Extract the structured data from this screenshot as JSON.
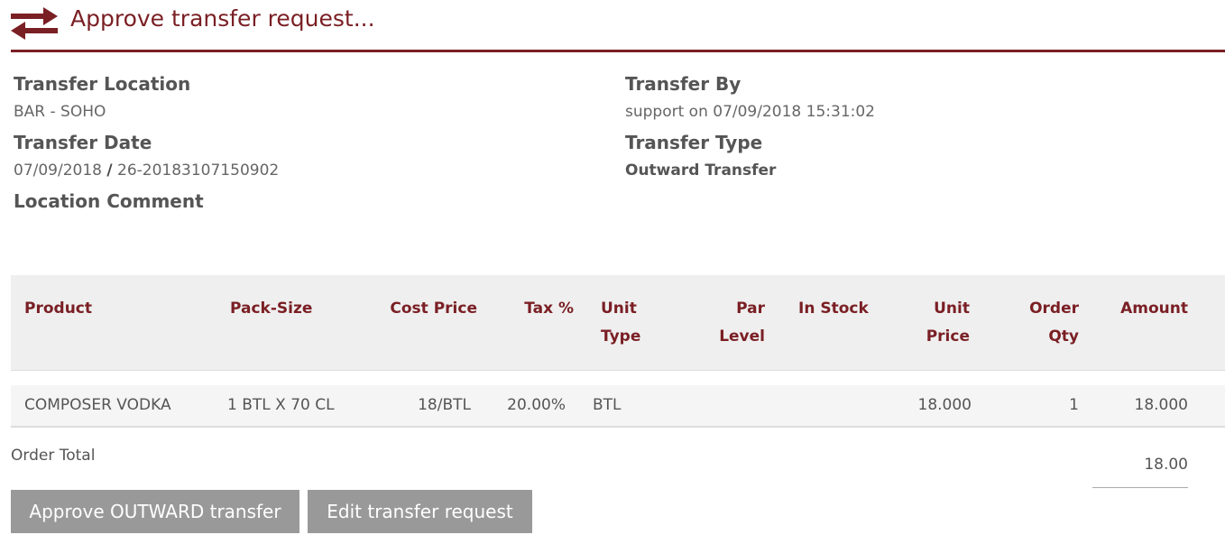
{
  "header": {
    "title": "Approve transfer request...",
    "icon": "transfer-arrows-icon",
    "accent_color": "#7a1f24"
  },
  "info": {
    "transfer_location_label": "Transfer Location",
    "transfer_location_value": "BAR - SOHO",
    "transfer_date_label": "Transfer Date",
    "transfer_date_value": "07/09/2018",
    "transfer_date_separator": "/",
    "transfer_reference": "26-20183107150902",
    "location_comment_label": "Location Comment",
    "transfer_by_label": "Transfer By",
    "transfer_by_value": "support on 07/09/2018 15:31:02",
    "transfer_type_label": "Transfer Type",
    "transfer_type_value": "Outward Transfer"
  },
  "table": {
    "headers": {
      "product": "Product",
      "pack_size": "Pack-Size",
      "cost_price": "Cost Price",
      "tax": "Tax %",
      "unit_type_1": "Unit",
      "unit_type_2": "Type",
      "par_level_1": "Par",
      "par_level_2": "Level",
      "in_stock": "In Stock",
      "unit_price_1": "Unit",
      "unit_price_2": "Price",
      "order_qty_1": "Order",
      "order_qty_2": "Qty",
      "amount": "Amount"
    },
    "rows": [
      {
        "product": "COMPOSER VODKA",
        "pack_size": "1 BTL X 70 CL",
        "cost_price": "18/BTL",
        "tax": "20.00%",
        "unit_type": "BTL",
        "par_level": "",
        "in_stock": "",
        "unit_price": "18.000",
        "order_qty": "1",
        "amount": "18.000"
      }
    ]
  },
  "order_total": {
    "label": "Order Total",
    "value": "18.00"
  },
  "buttons": {
    "approve": "Approve OUTWARD transfer",
    "edit": "Edit transfer request"
  }
}
